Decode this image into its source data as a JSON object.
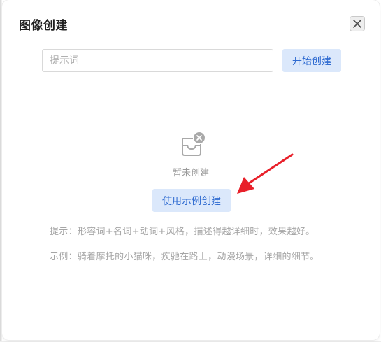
{
  "dialog": {
    "title": "图像创建",
    "close_icon": "close-icon"
  },
  "prompt": {
    "placeholder": "提示词",
    "value": ""
  },
  "start_button": {
    "label": "开始创建"
  },
  "empty_state": {
    "icon": "empty-inbox-icon",
    "text": "暂未创建"
  },
  "example_button": {
    "label": "使用示例创建"
  },
  "hint": {
    "text": "提示：形容词+名词+动词+风格，描述得越详细时，效果越好。"
  },
  "example": {
    "text": "示例：骑着摩托的小猫咪，疾驰在路上，动漫场景，详细的细节。"
  },
  "colors": {
    "accent": "#2f6bd1",
    "button_bg": "#dbe8fb",
    "annotation_arrow": "#e8202a"
  }
}
